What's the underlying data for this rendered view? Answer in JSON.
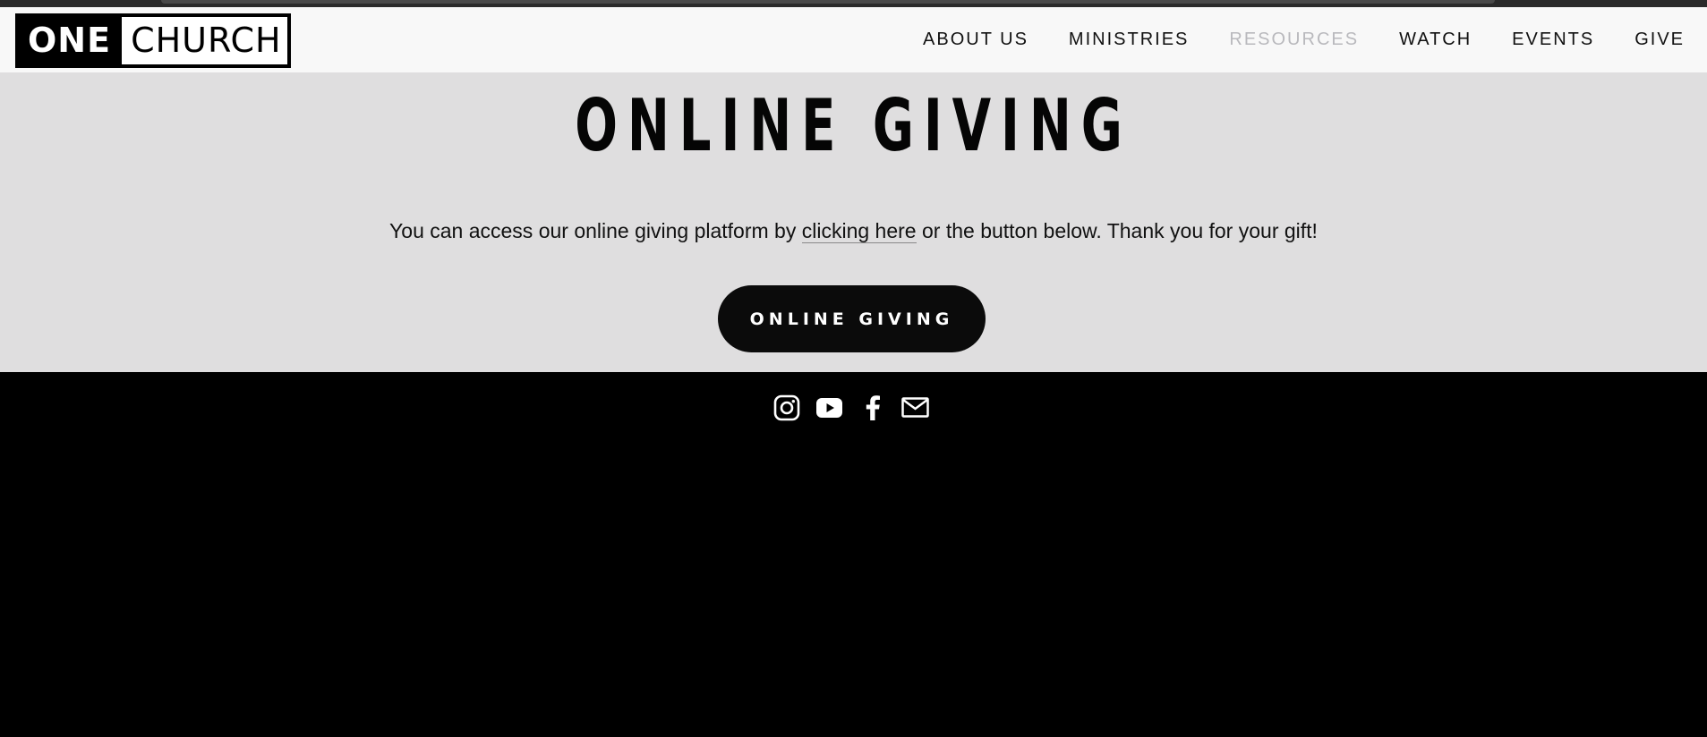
{
  "header": {
    "logo": {
      "part1": "ONE",
      "part2": "CHURCH"
    },
    "nav": [
      {
        "label": "ABOUT US",
        "state": "normal"
      },
      {
        "label": "MINISTRIES",
        "state": "normal"
      },
      {
        "label": "RESOURCES",
        "state": "muted"
      },
      {
        "label": "WATCH",
        "state": "normal"
      },
      {
        "label": "EVENTS",
        "state": "normal"
      },
      {
        "label": "GIVE",
        "state": "normal"
      }
    ]
  },
  "main": {
    "title": "ONLINE GIVING",
    "intro_before": "You can access our online giving platform by ",
    "intro_link": "clicking here",
    "intro_after": " or the button below. Thank you for your gift!",
    "button_label": "ONLINE GIVING",
    "background": "#dfdedf"
  },
  "footer": {
    "social_icons": [
      "instagram-icon",
      "youtube-icon",
      "facebook-icon",
      "email-icon"
    ],
    "background": "#000000"
  },
  "colors": {
    "header_bg": "#f8f8f8",
    "nav_muted": "#b9b9bd",
    "button_bg": "#0b0b0b"
  }
}
